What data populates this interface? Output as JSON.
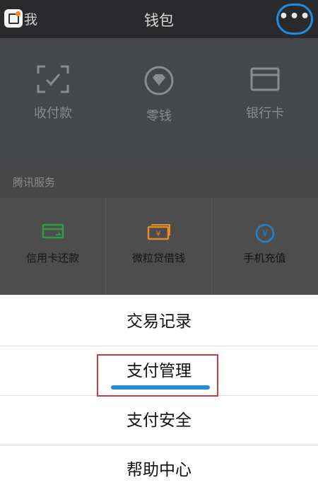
{
  "nav": {
    "back_label": "我",
    "title": "钱包",
    "more_label": "•••"
  },
  "wallet": {
    "items": [
      {
        "label": "收付款",
        "icon": "scan-icon"
      },
      {
        "label": "零钱",
        "icon": "diamond-coin-icon"
      },
      {
        "label": "银行卡",
        "icon": "card-icon"
      }
    ]
  },
  "services": {
    "header": "腾讯服务",
    "items": [
      {
        "label": "信用卡还款",
        "icon": "credit-card-repay-icon",
        "color": "#2c9d43"
      },
      {
        "label": "微粒贷借钱",
        "icon": "loan-icon",
        "color": "#e98a25"
      },
      {
        "label": "手机充值",
        "icon": "phone-topup-icon",
        "color": "#2d7fc4"
      }
    ]
  },
  "action_sheet": {
    "items": [
      {
        "label": "交易记录"
      },
      {
        "label": "支付管理"
      },
      {
        "label": "支付安全"
      },
      {
        "label": "帮助中心"
      }
    ]
  },
  "colors": {
    "annotation_circle": "#1e8fe0",
    "annotation_box": "#d0393b",
    "annotation_underline": "#1f8fd6"
  }
}
